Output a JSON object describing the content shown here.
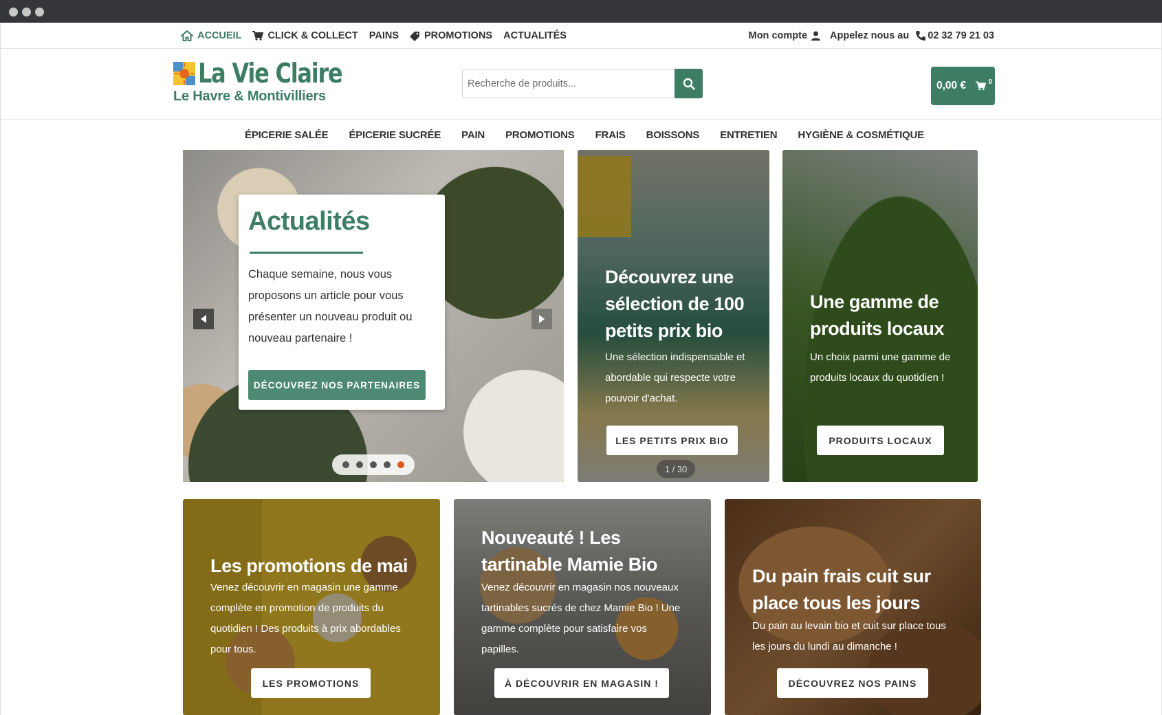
{
  "colors": {
    "brand_green": "#3c7d64",
    "slider_active_dot": "#e05a1f"
  },
  "topbar": {
    "links": [
      {
        "label": "ACCUEIL",
        "icon": "home-icon",
        "active": true
      },
      {
        "label": "CLICK & COLLECT",
        "icon": "cart-icon"
      },
      {
        "label": "PAINS"
      },
      {
        "label": "PROMOTIONS",
        "icon": "tag-icon"
      },
      {
        "label": "ACTUALITÉS"
      }
    ],
    "account_label": "Mon compte",
    "call_label": "Appelez nous au",
    "phone": "02 32 79 21 03"
  },
  "header": {
    "brand_name": "La Vie Claire",
    "brand_sub": "Le Havre & Montivilliers",
    "search_placeholder": "Recherche de produits...",
    "cart_total": "0,00 €",
    "cart_count": "0"
  },
  "categories": [
    "ÉPICERIE SALÉE",
    "ÉPICERIE SUCRÉE",
    "PAIN",
    "PROMOTIONS",
    "FRAIS",
    "BOISSONS",
    "ENTRETIEN",
    "HYGIÈNE & COSMÉTIQUE"
  ],
  "hero": {
    "title": "Actualités",
    "text": "Chaque semaine, nous vous proposons un article pour vous présenter un nouveau produit ou nouveau partenaire !",
    "button": "DÉCOUVREZ NOS PARTENAIRES",
    "slide_count": 5,
    "active_slide": 5
  },
  "cards": [
    {
      "title": "Découvrez une sélection de 100 petits prix bio",
      "text": "Une sélection indispensable et abordable qui respecte votre pouvoir d'achat.",
      "button": "LES PETITS PRIX BIO",
      "pager": "1 / 30"
    },
    {
      "title": "Une gamme de produits locaux",
      "text": "Un choix parmi une gamme de produits locaux du quotidien !",
      "button": "PRODUITS LOCAUX"
    },
    {
      "title": "Les promotions de mai",
      "text": "Venez découvrir en magasin une gamme complète en promotion de produits du quotidien ! Des produits à prix abordables pour tous.",
      "button": "LES PROMOTIONS"
    },
    {
      "title": "Nouveauté ! Les tartinable Mamie Bio",
      "text": "Venez découvrir en magasin nos nouveaux tartinables sucrés de chez Mamie Bio ! Une gamme complète pour satisfaire vos papilles.",
      "button": "À DÉCOUVRIR EN MAGASIN !"
    },
    {
      "title": "Du pain frais cuit sur place tous les jours",
      "text": "Du pain au levain bio et cuit sur place tous les jours du lundi au dimanche !",
      "button": "DÉCOUVREZ NOS PAINS"
    }
  ]
}
